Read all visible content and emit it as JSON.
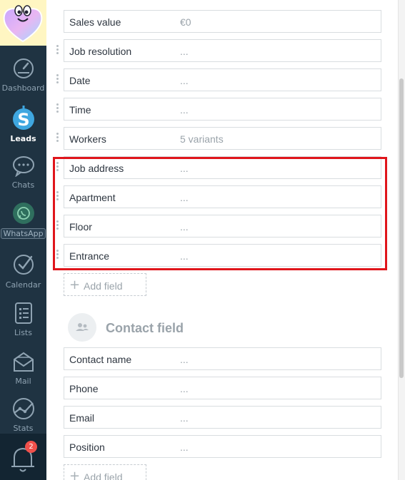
{
  "sidebar": {
    "items": [
      {
        "label": "Dashboard",
        "icon": "dashboard-icon"
      },
      {
        "label": "Leads",
        "icon": "leads-dollar-icon"
      },
      {
        "label": "Chats",
        "icon": "chat-bubble-icon"
      },
      {
        "label": "WhatsApp",
        "icon": "whatsapp-icon"
      },
      {
        "label": "Calendar",
        "icon": "calendar-check-icon"
      },
      {
        "label": "Lists",
        "icon": "lists-icon"
      },
      {
        "label": "Mail",
        "icon": "mail-icon"
      },
      {
        "label": "Stats",
        "icon": "stats-icon"
      }
    ],
    "notifications": {
      "icon": "bell-icon",
      "count": "2"
    },
    "logo_icon": "heart-mascot-logo"
  },
  "lead_fields": [
    {
      "name": "Sales value",
      "value": "€0"
    },
    {
      "name": "Job resolution",
      "value": "..."
    },
    {
      "name": "Date",
      "value": "..."
    },
    {
      "name": "Time",
      "value": "..."
    },
    {
      "name": "Workers",
      "value": "5 variants"
    },
    {
      "name": "Job address",
      "value": "..."
    },
    {
      "name": "Apartment",
      "value": "..."
    },
    {
      "name": "Floor",
      "value": "..."
    },
    {
      "name": "Entrance",
      "value": "..."
    }
  ],
  "add_field_label": "Add field",
  "contact_section": {
    "title": "Contact field",
    "icon": "contact-people-icon",
    "fields": [
      {
        "name": "Contact name",
        "value": "..."
      },
      {
        "name": "Phone",
        "value": "..."
      },
      {
        "name": "Email",
        "value": "..."
      },
      {
        "name": "Position",
        "value": "..."
      }
    ],
    "add_field_label": "Add field"
  },
  "colors": {
    "sidebar_bg": "#1f3342",
    "highlight_border": "#e0151b",
    "badge": "#f0504b",
    "leads_accent": "#3fa7e0"
  }
}
